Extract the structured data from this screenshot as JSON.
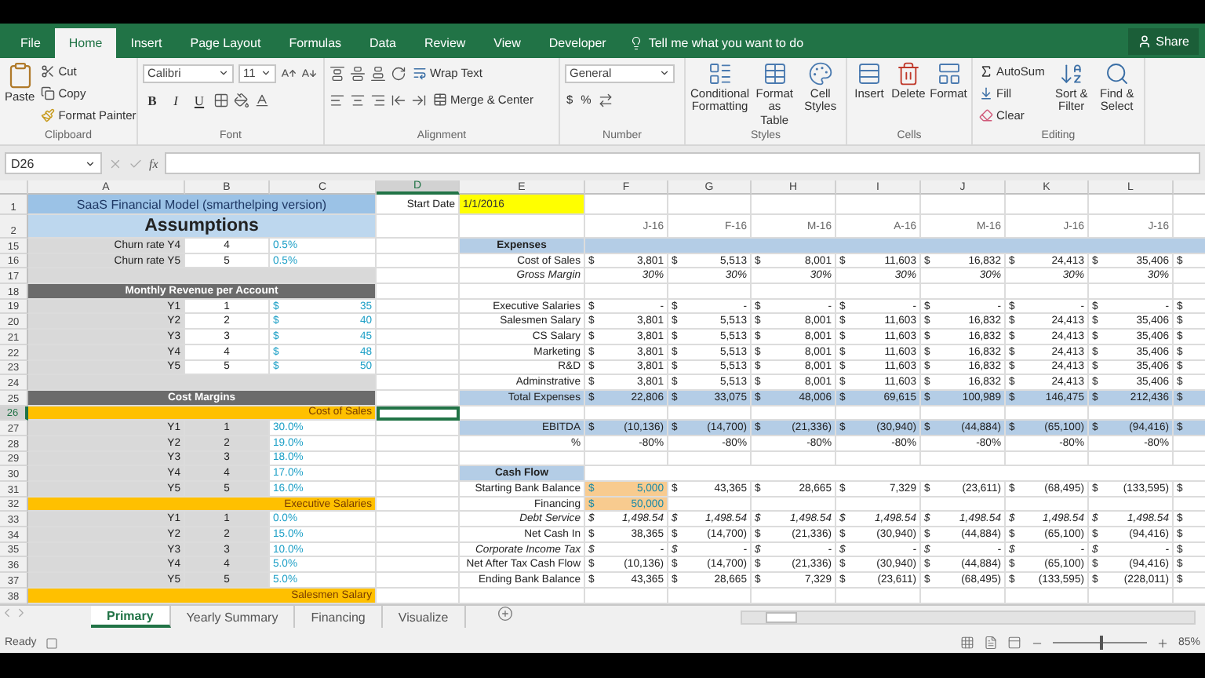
{
  "ribbon_tabs": [
    {
      "label": "File",
      "selected": false
    },
    {
      "label": "Home",
      "selected": true
    },
    {
      "label": "Insert",
      "selected": false
    },
    {
      "label": "Page Layout",
      "selected": false
    },
    {
      "label": "Formulas",
      "selected": false
    },
    {
      "label": "Data",
      "selected": false
    },
    {
      "label": "Review",
      "selected": false
    },
    {
      "label": "View",
      "selected": false
    },
    {
      "label": "Developer",
      "selected": false
    }
  ],
  "tell_me": "Tell me what you want to do",
  "share": "Share",
  "ribbon_groups": [
    {
      "kind": "clipboard",
      "name": "Clipboard",
      "paste": "Paste",
      "cut": "Cut",
      "copy": "Copy",
      "format_painter": "Format Painter"
    },
    {
      "kind": "font",
      "name": "Font",
      "font": "Calibri",
      "size": "11",
      "bold": "B",
      "italic": "I",
      "underline": "U"
    },
    {
      "kind": "alignment",
      "name": "Alignment",
      "wrap": "Wrap Text",
      "merge": "Merge & Center"
    },
    {
      "kind": "number",
      "name": "Number",
      "format": "General",
      "currency": "$",
      "percent": "%"
    },
    {
      "kind": "styles",
      "name": "Styles",
      "buttons": [
        "Conditional Formatting",
        "Format as Table",
        "Cell Styles"
      ]
    },
    {
      "kind": "cells",
      "name": "Cells",
      "buttons": [
        "Insert",
        "Delete",
        "Format"
      ]
    },
    {
      "kind": "editing",
      "name": "Editing",
      "autosum": "AutoSum",
      "fill": "Fill",
      "clear": "Clear",
      "buttons": [
        "Sort & Filter",
        "Find & Select"
      ]
    }
  ],
  "formula_bar": {
    "name_box": "D26",
    "function_label": "fx"
  },
  "columns": [
    {
      "label": "A",
      "selected": false
    },
    {
      "label": "B",
      "selected": false
    },
    {
      "label": "C",
      "selected": false
    },
    {
      "label": "D",
      "selected": true
    },
    {
      "label": "E",
      "selected": false
    },
    {
      "label": "F",
      "selected": false
    },
    {
      "label": "G",
      "selected": false
    },
    {
      "label": "H",
      "selected": false
    },
    {
      "label": "I",
      "selected": false
    },
    {
      "label": "J",
      "selected": false
    },
    {
      "label": "K",
      "selected": false
    },
    {
      "label": "L",
      "selected": false
    }
  ],
  "rows": [
    {
      "number": "1",
      "selected": false,
      "left": {
        "kind": "title",
        "label": "SaaS Financial Model (smarthelping version)"
      },
      "right": {
        "kind": "start",
        "label": "Start Date",
        "value": "1/1/2016"
      }
    },
    {
      "number": "2",
      "selected": false,
      "left": {
        "kind": "heading",
        "label": "Assumptions"
      },
      "right": {
        "kind": "months",
        "values": [
          "J-16",
          "F-16",
          "M-16",
          "A-16",
          "M-16",
          "J-16",
          "J-16"
        ]
      }
    },
    {
      "number": "15",
      "selected": false,
      "left": {
        "kind": "input",
        "label": "Churn rate Y4",
        "index": "4",
        "value": "0.5%"
      },
      "right": {
        "kind": "header",
        "label": "Expenses",
        "full_width": true
      }
    },
    {
      "number": "16",
      "selected": false,
      "left": {
        "kind": "input",
        "label": "Churn rate Y5",
        "index": "5",
        "value": "0.5%"
      },
      "right": {
        "kind": "money",
        "label": "Cost of Sales",
        "italic": false,
        "highlighted": false,
        "symbol": "$",
        "values": [
          "3,801",
          "5,513",
          "8,001",
          "11,603",
          "16,832",
          "24,413",
          "35,406"
        ],
        "column_m": "$"
      }
    },
    {
      "number": "17",
      "selected": false,
      "left": {
        "kind": "blank"
      },
      "right": {
        "kind": "plain",
        "label": "Gross Margin",
        "italic": true,
        "highlighted": false,
        "values": [
          "30%",
          "30%",
          "30%",
          "30%",
          "30%",
          "30%",
          "30%"
        ]
      }
    },
    {
      "number": "18",
      "selected": false,
      "left": {
        "kind": "section",
        "label": "Monthly Revenue per Account"
      },
      "right": {
        "kind": "blank"
      }
    },
    {
      "number": "19",
      "selected": false,
      "left": {
        "kind": "money",
        "label": "Y1",
        "index": "1",
        "symbol": "$",
        "value": "35"
      },
      "right": {
        "kind": "money",
        "label": "Executive Salaries",
        "italic": false,
        "highlighted": false,
        "symbol": "$",
        "values": [
          "-",
          "-",
          "-",
          "-",
          "-",
          "-",
          "-"
        ],
        "column_m": "$"
      }
    },
    {
      "number": "20",
      "selected": false,
      "left": {
        "kind": "money",
        "label": "Y2",
        "index": "2",
        "symbol": "$",
        "value": "40"
      },
      "right": {
        "kind": "money",
        "label": "Salesmen Salary",
        "italic": false,
        "highlighted": false,
        "symbol": "$",
        "values": [
          "3,801",
          "5,513",
          "8,001",
          "11,603",
          "16,832",
          "24,413",
          "35,406"
        ],
        "column_m": "$"
      }
    },
    {
      "number": "21",
      "selected": false,
      "left": {
        "kind": "money",
        "label": "Y3",
        "index": "3",
        "symbol": "$",
        "value": "45"
      },
      "right": {
        "kind": "money",
        "label": "CS Salary",
        "italic": false,
        "highlighted": false,
        "symbol": "$",
        "values": [
          "3,801",
          "5,513",
          "8,001",
          "11,603",
          "16,832",
          "24,413",
          "35,406"
        ],
        "column_m": "$"
      }
    },
    {
      "number": "22",
      "selected": false,
      "left": {
        "kind": "money",
        "label": "Y4",
        "index": "4",
        "symbol": "$",
        "value": "48"
      },
      "right": {
        "kind": "money",
        "label": "Marketing",
        "italic": false,
        "highlighted": false,
        "symbol": "$",
        "values": [
          "3,801",
          "5,513",
          "8,001",
          "11,603",
          "16,832",
          "24,413",
          "35,406"
        ],
        "column_m": "$"
      }
    },
    {
      "number": "23",
      "selected": false,
      "left": {
        "kind": "money",
        "label": "Y5",
        "index": "5",
        "symbol": "$",
        "value": "50"
      },
      "right": {
        "kind": "money",
        "label": "R&D",
        "italic": false,
        "highlighted": false,
        "symbol": "$",
        "values": [
          "3,801",
          "5,513",
          "8,001",
          "11,603",
          "16,832",
          "24,413",
          "35,406"
        ],
        "column_m": "$"
      }
    },
    {
      "number": "24",
      "selected": false,
      "left": {
        "kind": "blank"
      },
      "right": {
        "kind": "money",
        "label": "Adminstrative",
        "italic": false,
        "highlighted": false,
        "symbol": "$",
        "values": [
          "3,801",
          "5,513",
          "8,001",
          "11,603",
          "16,832",
          "24,413",
          "35,406"
        ],
        "column_m": "$"
      }
    },
    {
      "number": "25",
      "selected": false,
      "left": {
        "kind": "section",
        "label": "Cost Margins"
      },
      "right": {
        "kind": "money",
        "label": "Total Expenses",
        "italic": false,
        "highlighted": true,
        "symbol": "$",
        "values": [
          "22,806",
          "33,075",
          "48,006",
          "69,615",
          "100,989",
          "146,475",
          "212,436"
        ],
        "column_m": "$"
      }
    },
    {
      "number": "26",
      "selected": true,
      "left": {
        "kind": "band",
        "label": "Cost of Sales"
      },
      "right": {
        "kind": "blank"
      }
    },
    {
      "number": "27",
      "selected": false,
      "left": {
        "kind": "rate",
        "label": "Y1",
        "index": "1",
        "value": "30.0%"
      },
      "right": {
        "kind": "money",
        "label": "EBITDA",
        "italic": false,
        "highlighted": true,
        "symbol": "$",
        "values": [
          "(10,136)",
          "(14,700)",
          "(21,336)",
          "(30,940)",
          "(44,884)",
          "(65,100)",
          "(94,416)"
        ],
        "column_m": "$"
      }
    },
    {
      "number": "28",
      "selected": false,
      "left": {
        "kind": "rate",
        "label": "Y2",
        "index": "2",
        "value": "19.0%"
      },
      "right": {
        "kind": "plain",
        "label": "%",
        "italic": false,
        "highlighted": false,
        "values": [
          "-80%",
          "-80%",
          "-80%",
          "-80%",
          "-80%",
          "-80%",
          "-80%"
        ]
      }
    },
    {
      "number": "29",
      "selected": false,
      "left": {
        "kind": "rate",
        "label": "Y3",
        "index": "3",
        "value": "18.0%"
      },
      "right": {
        "kind": "blank"
      }
    },
    {
      "number": "30",
      "selected": false,
      "left": {
        "kind": "rate",
        "label": "Y4",
        "index": "4",
        "value": "17.0%"
      },
      "right": {
        "kind": "header",
        "label": "Cash Flow",
        "full_width": false
      }
    },
    {
      "number": "31",
      "selected": false,
      "left": {
        "kind": "rate",
        "label": "Y5",
        "index": "5",
        "value": "16.0%"
      },
      "right": {
        "kind": "money",
        "label": "Starting Bank Balance",
        "italic": false,
        "highlighted": false,
        "symbol": "$",
        "input": {
          "symbol": "$",
          "value": "5,000"
        },
        "values": [
          "43,365",
          "28,665",
          "7,329",
          "(23,611)",
          "(68,495)",
          "(133,595)"
        ],
        "column_m": "$"
      }
    },
    {
      "number": "32",
      "selected": false,
      "left": {
        "kind": "band",
        "label": "Executive Salaries"
      },
      "right": {
        "kind": "money",
        "label": "Financing",
        "italic": false,
        "highlighted": false,
        "input": {
          "symbol": "$",
          "value": "50,000"
        }
      }
    },
    {
      "number": "33",
      "selected": false,
      "left": {
        "kind": "rate",
        "label": "Y1",
        "index": "1",
        "value": "0.0%"
      },
      "right": {
        "kind": "money",
        "label": "Debt Service",
        "italic": true,
        "highlighted": false,
        "symbol": "$",
        "values": [
          "1,498.54",
          "1,498.54",
          "1,498.54",
          "1,498.54",
          "1,498.54",
          "1,498.54",
          "1,498.54"
        ],
        "column_m": "$"
      }
    },
    {
      "number": "34",
      "selected": false,
      "left": {
        "kind": "rate",
        "label": "Y2",
        "index": "2",
        "value": "15.0%"
      },
      "right": {
        "kind": "money",
        "label": "Net Cash In",
        "italic": false,
        "highlighted": false,
        "symbol": "$",
        "values": [
          "38,365",
          "(14,700)",
          "(21,336)",
          "(30,940)",
          "(44,884)",
          "(65,100)",
          "(94,416)"
        ],
        "column_m": "$"
      }
    },
    {
      "number": "35",
      "selected": false,
      "left": {
        "kind": "rate",
        "label": "Y3",
        "index": "3",
        "value": "10.0%"
      },
      "right": {
        "kind": "money",
        "label": "Corporate Income Tax",
        "italic": true,
        "highlighted": false,
        "symbol": "$",
        "values": [
          "-",
          "-",
          "-",
          "-",
          "-",
          "-",
          "-"
        ],
        "column_m": "$"
      }
    },
    {
      "number": "36",
      "selected": false,
      "left": {
        "kind": "rate",
        "label": "Y4",
        "index": "4",
        "value": "5.0%"
      },
      "right": {
        "kind": "money",
        "label": "Net After Tax Cash Flow",
        "italic": false,
        "highlighted": false,
        "symbol": "$",
        "values": [
          "(10,136)",
          "(14,700)",
          "(21,336)",
          "(30,940)",
          "(44,884)",
          "(65,100)",
          "(94,416)"
        ],
        "column_m": "$"
      }
    },
    {
      "number": "37",
      "selected": false,
      "left": {
        "kind": "rate",
        "label": "Y5",
        "index": "5",
        "value": "5.0%"
      },
      "right": {
        "kind": "money",
        "label": "Ending Bank Balance",
        "italic": false,
        "highlighted": false,
        "symbol": "$",
        "values": [
          "43,365",
          "28,665",
          "7,329",
          "(23,611)",
          "(68,495)",
          "(133,595)",
          "(228,011)"
        ],
        "column_m": "$"
      }
    },
    {
      "number": "38",
      "selected": false,
      "left": {
        "kind": "band",
        "label": "Salesmen Salary"
      },
      "right": {
        "kind": "blank"
      }
    }
  ],
  "sheet_tabs": [
    {
      "label": "Primary",
      "selected": true
    },
    {
      "label": "Yearly Summary",
      "selected": false
    },
    {
      "label": "Financing",
      "selected": false
    },
    {
      "label": "Visualize",
      "selected": false
    }
  ],
  "status_bar": {
    "status": "Ready",
    "zoom": "85%",
    "zoom_slider": {
      "level": 0.5
    }
  }
}
